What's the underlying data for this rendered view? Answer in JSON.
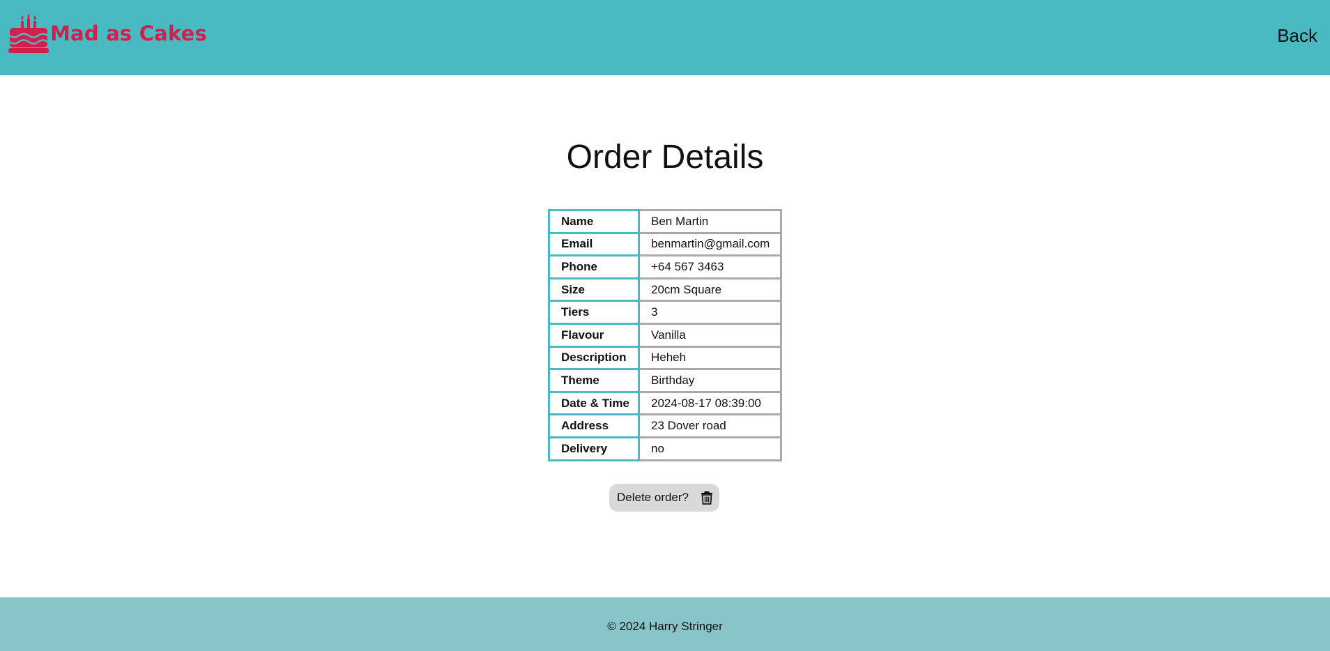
{
  "header": {
    "brand_name": "Mad as Cakes",
    "brand_icon": "cake-icon",
    "back_label": "Back"
  },
  "main": {
    "title": "Order Details",
    "order_rows": [
      {
        "label": "Name",
        "value": "Ben Martin"
      },
      {
        "label": "Email",
        "value": "benmartin@gmail.com"
      },
      {
        "label": "Phone",
        "value": "+64 567 3463"
      },
      {
        "label": "Size",
        "value": "20cm Square"
      },
      {
        "label": "Tiers",
        "value": "3"
      },
      {
        "label": "Flavour",
        "value": "Vanilla"
      },
      {
        "label": "Description",
        "value": "Heheh"
      },
      {
        "label": "Theme",
        "value": "Birthday"
      },
      {
        "label": "Date & Time",
        "value": "2024-08-17 08:39:00"
      },
      {
        "label": "Address",
        "value": "23 Dover road"
      },
      {
        "label": "Delivery",
        "value": "no"
      }
    ],
    "delete_label": "Delete order?",
    "delete_icon": "trash-icon"
  },
  "footer": {
    "copyright": "© 2024 Harry Stringer"
  },
  "colors": {
    "header_bg": "#49bac2",
    "brand": "#d11f4e",
    "label_border": "#49bac2",
    "value_border": "#aaaaaa",
    "button_bg": "#d9d9d9",
    "footer_bg": "#89c4c8"
  }
}
